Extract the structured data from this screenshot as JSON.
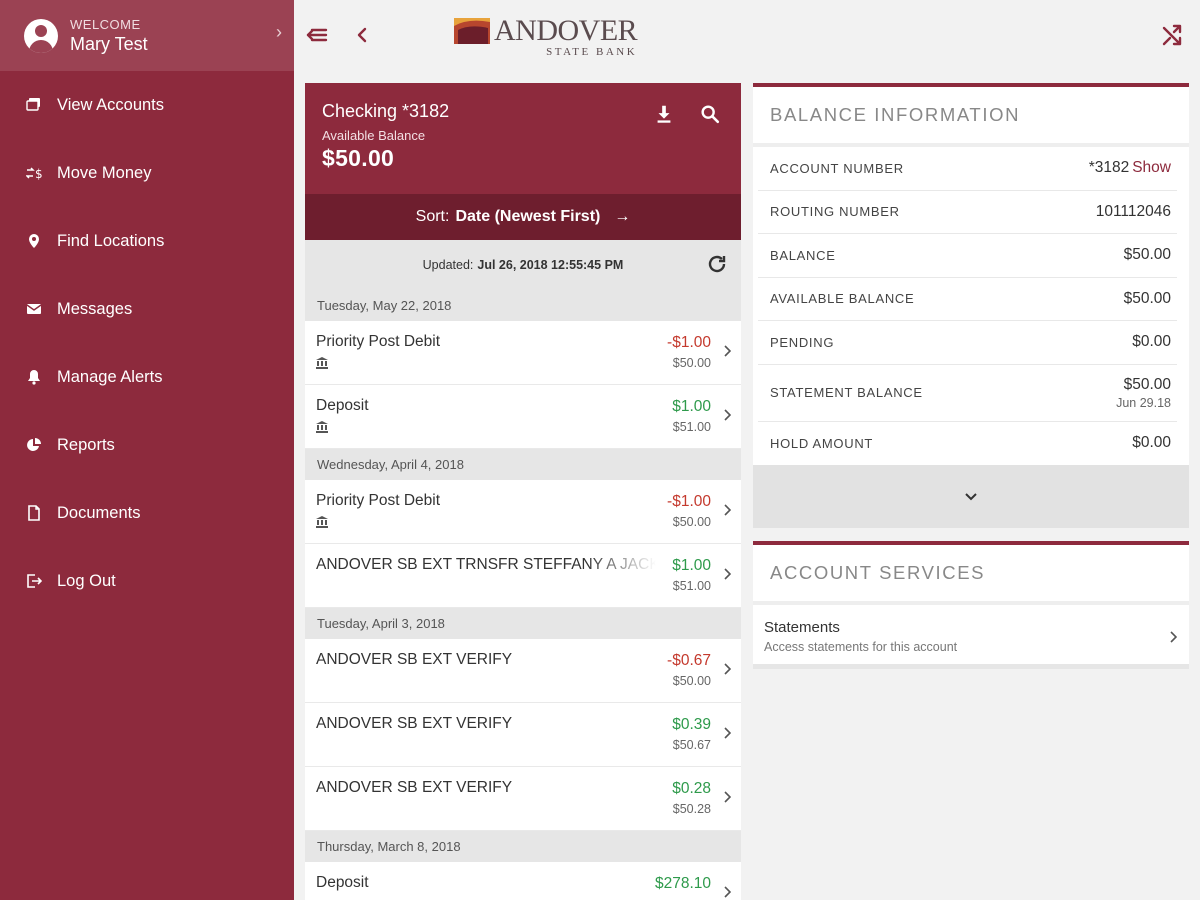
{
  "sidebar": {
    "welcome_label": "WELCOME",
    "user_name": "Mary Test",
    "items": [
      {
        "label": "View Accounts",
        "icon": "accounts-icon"
      },
      {
        "label": "Move Money",
        "icon": "transfer-icon"
      },
      {
        "label": "Find Locations",
        "icon": "location-pin-icon"
      },
      {
        "label": "Messages",
        "icon": "envelope-icon"
      },
      {
        "label": "Manage Alerts",
        "icon": "bell-icon"
      },
      {
        "label": "Reports",
        "icon": "pie-chart-icon"
      },
      {
        "label": "Documents",
        "icon": "document-icon"
      },
      {
        "label": "Log Out",
        "icon": "logout-icon"
      }
    ]
  },
  "brand": {
    "name": "ANDOVER",
    "subtitle": "STATE BANK",
    "accent": "#8d2a3d"
  },
  "account": {
    "name": "Checking *3182",
    "available_label": "Available Balance",
    "available_balance": "$50.00",
    "sort_label": "Sort:",
    "sort_value": "Date (Newest First)",
    "updated_label": "Updated:",
    "updated_value": "Jul 26, 2018 12:55:45 PM"
  },
  "transactions": {
    "groups": [
      {
        "date": "Tuesday, May 22, 2018",
        "items": [
          {
            "desc": "Priority Post Debit",
            "amount": "-$1.00",
            "running": "$50.00",
            "sign": "neg",
            "bank_icon": true
          },
          {
            "desc": "Deposit",
            "amount": "$1.00",
            "running": "$51.00",
            "sign": "pos",
            "bank_icon": true
          }
        ]
      },
      {
        "date": "Wednesday, April 4, 2018",
        "items": [
          {
            "desc": "Priority Post Debit",
            "amount": "-$1.00",
            "running": "$50.00",
            "sign": "neg",
            "bank_icon": true
          },
          {
            "desc": "ANDOVER SB EXT TRNSFR STEFFANY A JACK",
            "amount": "$1.00",
            "running": "$51.00",
            "sign": "pos",
            "bank_icon": false
          }
        ]
      },
      {
        "date": "Tuesday, April 3, 2018",
        "items": [
          {
            "desc": "ANDOVER SB EXT VERIFY",
            "amount": "-$0.67",
            "running": "$50.00",
            "sign": "neg",
            "bank_icon": false
          },
          {
            "desc": "ANDOVER SB EXT VERIFY",
            "amount": "$0.39",
            "running": "$50.67",
            "sign": "pos",
            "bank_icon": false
          },
          {
            "desc": "ANDOVER SB EXT VERIFY",
            "amount": "$0.28",
            "running": "$50.28",
            "sign": "pos",
            "bank_icon": false
          }
        ]
      },
      {
        "date": "Thursday, March 8, 2018",
        "items": [
          {
            "desc": "Deposit",
            "amount": "$278.10",
            "running": "",
            "sign": "pos",
            "bank_icon": false
          }
        ]
      }
    ]
  },
  "balance_info": {
    "title": "BALANCE INFORMATION",
    "rows": [
      {
        "key": "ACCOUNT NUMBER",
        "value": "*3182",
        "link": "Show",
        "sub": ""
      },
      {
        "key": "ROUTING NUMBER",
        "value": "101112046",
        "link": "",
        "sub": ""
      },
      {
        "key": "BALANCE",
        "value": "$50.00",
        "link": "",
        "sub": ""
      },
      {
        "key": "AVAILABLE BALANCE",
        "value": "$50.00",
        "link": "",
        "sub": ""
      },
      {
        "key": "PENDING",
        "value": "$0.00",
        "link": "",
        "sub": ""
      },
      {
        "key": "STATEMENT BALANCE",
        "value": "$50.00",
        "link": "",
        "sub": "Jun 29.18"
      },
      {
        "key": "HOLD AMOUNT",
        "value": "$0.00",
        "link": "",
        "sub": ""
      }
    ]
  },
  "account_services": {
    "title": "ACCOUNT SERVICES",
    "items": [
      {
        "title": "Statements",
        "subtitle": "Access statements for this account"
      }
    ]
  }
}
